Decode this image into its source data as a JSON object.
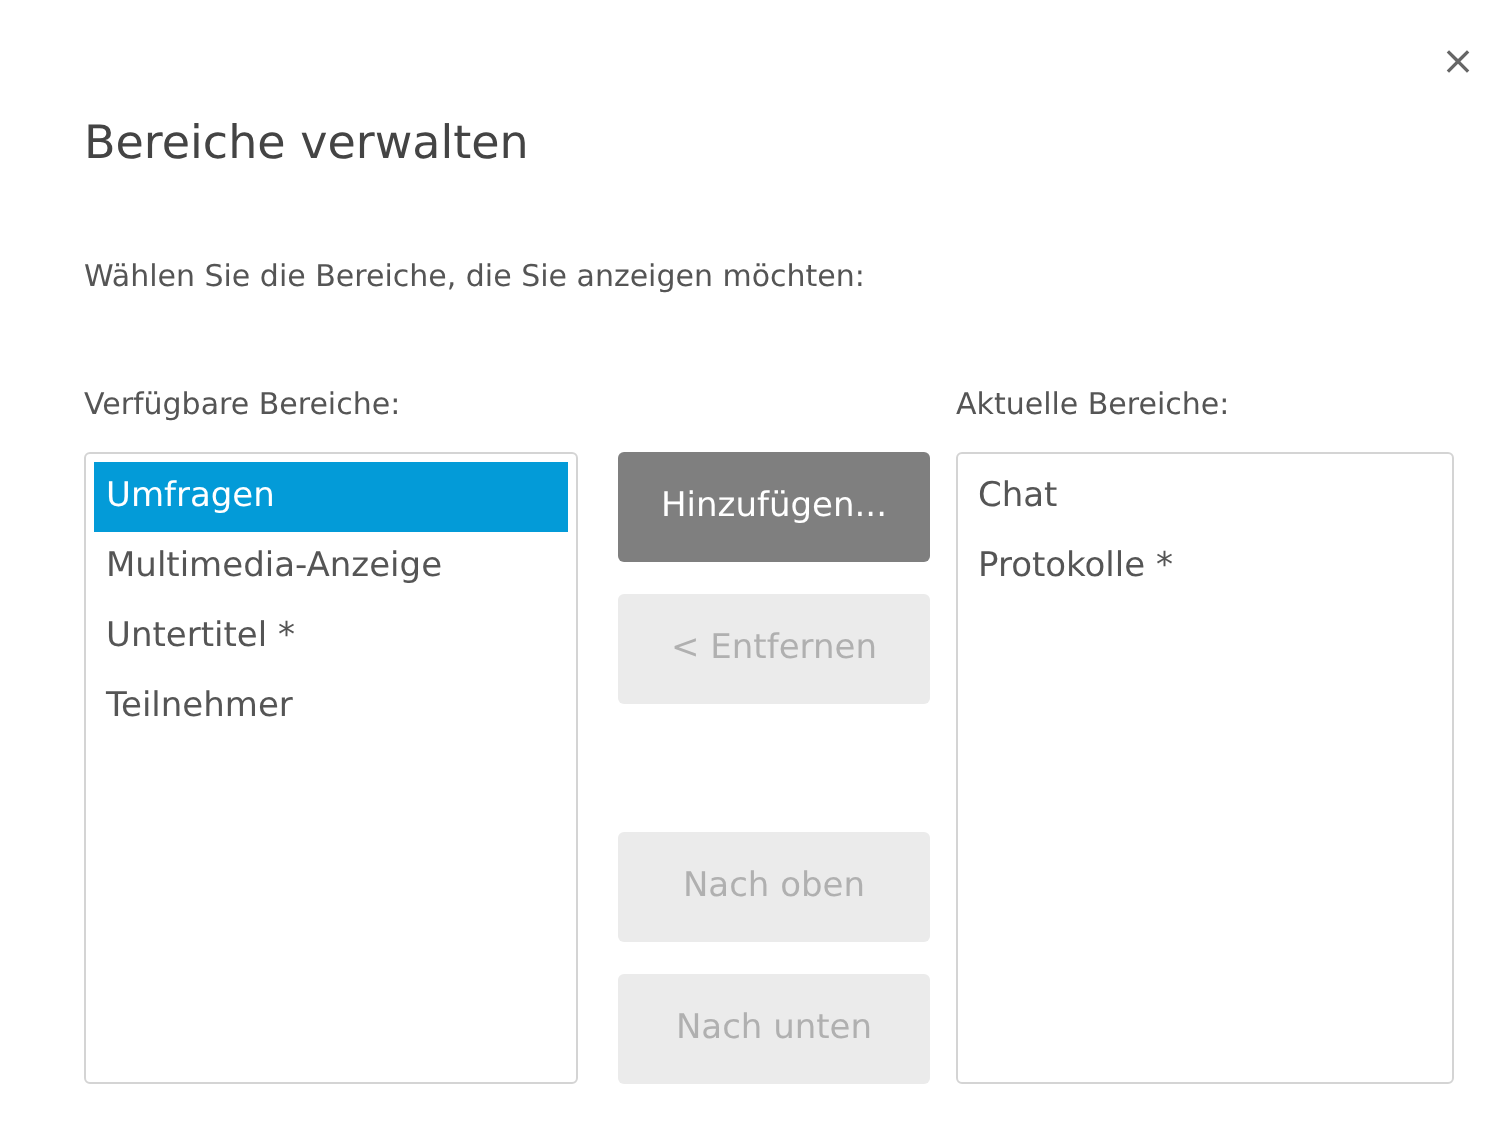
{
  "dialog": {
    "close": "×",
    "title": "Bereiche verwalten",
    "instruction": "Wählen Sie die Bereiche, die Sie anzeigen möchten:"
  },
  "available": {
    "label": "Verfügbare Bereiche:",
    "items": [
      {
        "label": "Umfragen",
        "selected": true
      },
      {
        "label": "Multimedia-Anzeige",
        "selected": false
      },
      {
        "label": "Untertitel *",
        "selected": false
      },
      {
        "label": "Teilnehmer",
        "selected": false
      }
    ]
  },
  "buttons": [
    {
      "label": "Hinzufügen...",
      "disabled": false
    },
    {
      "label": "< Entfernen",
      "disabled": true
    },
    {
      "label": "Nach oben",
      "disabled": true
    },
    {
      "label": "Nach unten",
      "disabled": true
    }
  ],
  "current": {
    "label": "Aktuelle Bereiche:",
    "items": [
      {
        "label": "Chat",
        "selected": false
      },
      {
        "label": "Protokolle *",
        "selected": false
      }
    ]
  }
}
